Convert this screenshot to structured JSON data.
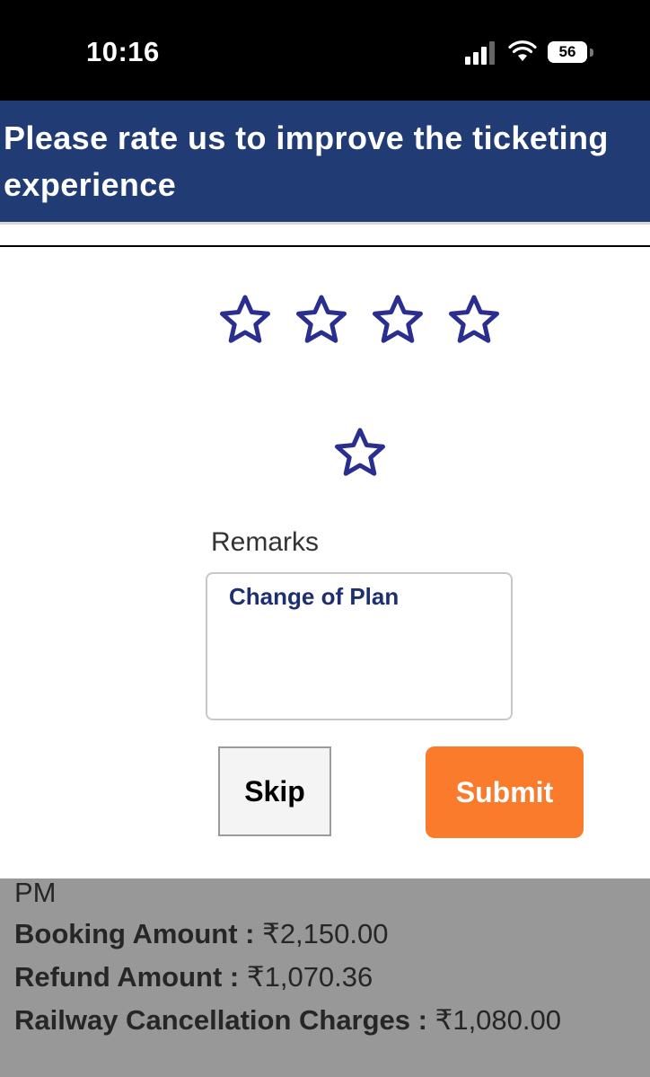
{
  "status_bar": {
    "time": "10:16",
    "battery": "56"
  },
  "header": {
    "title": "Please rate us to improve the ticketing experience"
  },
  "rating": {
    "max_stars": 5,
    "selected": 0,
    "star_color": "#2a2f8f"
  },
  "remarks": {
    "label": "Remarks",
    "value": "Change of Plan"
  },
  "buttons": {
    "skip": "Skip",
    "submit": "Submit",
    "submit_color": "#fb7b2c"
  },
  "background_info": {
    "partial_line": "PM",
    "booking_amount_label": "Booking Amount :",
    "booking_amount_value": "₹2,150.00",
    "refund_amount_label": "Refund Amount :",
    "refund_amount_value": "₹1,070.36",
    "cancellation_label": "Railway Cancellation Charges :",
    "cancellation_value": "₹1,080.00"
  },
  "colors": {
    "header_bg": "#213b74",
    "overlay_dim": "#989898"
  }
}
